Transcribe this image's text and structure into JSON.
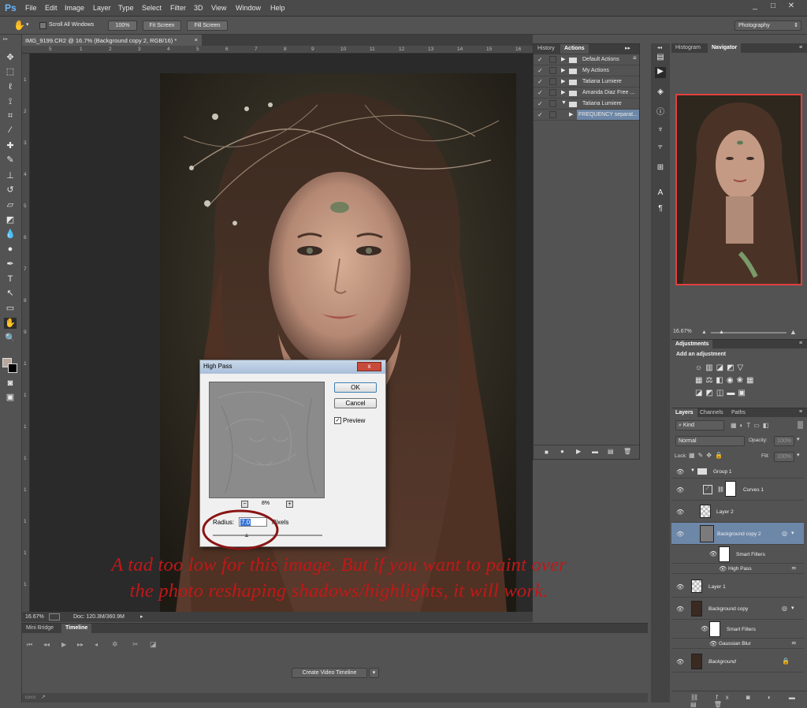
{
  "app": {
    "logo": "Ps",
    "workspace": "Photography"
  },
  "menu": [
    "File",
    "Edit",
    "Image",
    "Layer",
    "Type",
    "Select",
    "Filter",
    "3D",
    "View",
    "Window",
    "Help"
  ],
  "options": {
    "scroll_all": "Scroll All Windows",
    "zoom100": "100%",
    "fit": "Fit Screen",
    "fill": "Fill Screen"
  },
  "document": {
    "tab": "IMG_9199.CR2 @ 16.7% (Background copy 2, RGB/16) *",
    "ruler_h": [
      "5",
      "1",
      "2",
      "3",
      "4",
      "5",
      "6",
      "7",
      "8",
      "9",
      "10",
      "11",
      "12",
      "13",
      "14",
      "15",
      "16"
    ],
    "ruler_v": [
      "1",
      "2",
      "3",
      "4",
      "5",
      "6",
      "7",
      "8",
      "9",
      "1",
      "1",
      "1",
      "1",
      "1",
      "1",
      "1",
      "1"
    ]
  },
  "status": {
    "zoom": "16.67%",
    "doc": "Doc: 120.3M/360.9M"
  },
  "timeline": {
    "tabs": [
      "Mini Bridge",
      "Timeline"
    ],
    "create_button": "Create Video Timeline"
  },
  "actions_panel": {
    "tabs": [
      "History",
      "Actions"
    ],
    "items": [
      {
        "label": "Default Actions",
        "checked": true
      },
      {
        "label": "My Actions",
        "checked": true
      },
      {
        "label": "Tatiana Lumiere",
        "checked": true
      },
      {
        "label": "Amanda Diaz Free ...",
        "checked": true
      },
      {
        "label": "Tatiana Lumiere",
        "checked": true
      },
      {
        "label": "FREQUENCY separat...",
        "checked": true
      }
    ]
  },
  "navigator": {
    "tabs": [
      "Histogram",
      "Navigator"
    ],
    "zoom": "16.67%"
  },
  "adjustments": {
    "tab": "Adjustments",
    "title": "Add an adjustment"
  },
  "layers_panel": {
    "tabs": [
      "Layers",
      "Channels",
      "Paths"
    ],
    "kind": "Kind",
    "blend": "Normal",
    "opacity_label": "Opacity:",
    "opacity": "100%",
    "lock_label": "Lock:",
    "fill_label": "Fill:",
    "fill": "100%",
    "layers": [
      {
        "name": "Group 1"
      },
      {
        "name": "Curves 1"
      },
      {
        "name": "Layer 2"
      },
      {
        "name": "Background copy 2"
      },
      {
        "name": "Smart Filters"
      },
      {
        "name": "High Pass"
      },
      {
        "name": "Layer 1"
      },
      {
        "name": "Background copy"
      },
      {
        "name": "Smart Filters"
      },
      {
        "name": "Gaussian Blur"
      },
      {
        "name": "Background"
      }
    ]
  },
  "dialog": {
    "title": "High Pass",
    "close": "x",
    "ok": "OK",
    "cancel": "Cancel",
    "preview_label": "Preview",
    "zoom": "8%",
    "zoom_minus": "−",
    "zoom_plus": "+",
    "radius_label": "Radius:",
    "radius_value": "7.0",
    "units": "Pixels"
  },
  "annotation": {
    "line1": "A tad too low for this image. But if you want to paint over",
    "line2": "the photo reshaping shadows/highlights, it will work."
  },
  "colors": {
    "annotation": "#c01818",
    "selection": "#6d87a8",
    "highlight_border": "#e14040"
  }
}
